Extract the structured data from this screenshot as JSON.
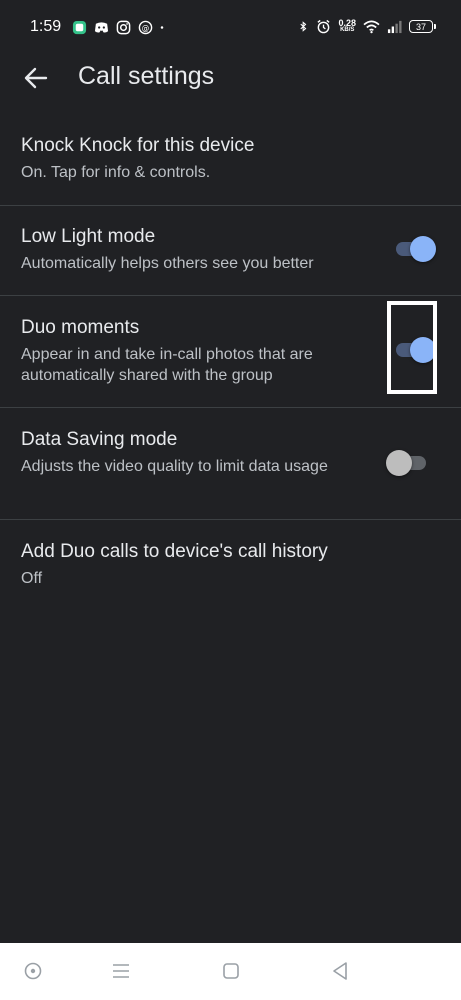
{
  "status_bar": {
    "time": "1:59",
    "net_speed_value": "0.28",
    "net_speed_unit": "KB/S",
    "battery_level": "37",
    "left_icons": [
      "app-notification-icon",
      "discord-icon",
      "instagram-icon",
      "threads-icon",
      "dot-icon"
    ],
    "right_icons": [
      "bluetooth-icon",
      "alarm-icon",
      "wifi-icon",
      "signal-icon",
      "battery-icon"
    ]
  },
  "app_bar": {
    "title": "Call settings",
    "back_icon": "arrow-back-icon"
  },
  "settings": [
    {
      "title": "Knock Knock for this device",
      "subtitle": "On. Tap for info & controls."
    },
    {
      "title": "Low Light mode",
      "subtitle": "Automatically helps others see you better",
      "toggle": true
    },
    {
      "title": "Duo moments",
      "subtitle": "Appear in and take in-call photos that are automatically shared with the group",
      "toggle": true
    },
    {
      "title": "Data Saving mode",
      "subtitle": "Adjusts the video quality to limit data usage",
      "toggle": false
    },
    {
      "title": "Add Duo calls to device's call history",
      "subtitle": "Off"
    }
  ],
  "nav_bar": {
    "icons": [
      "assistant-circle-icon",
      "menu-icon",
      "home-square-icon",
      "back-triangle-icon"
    ]
  },
  "colors": {
    "background": "#202124",
    "text_primary": "#e8eaed",
    "text_secondary": "#bdc1c6",
    "accent": "#8ab4f8",
    "divider": "#3c4043"
  }
}
